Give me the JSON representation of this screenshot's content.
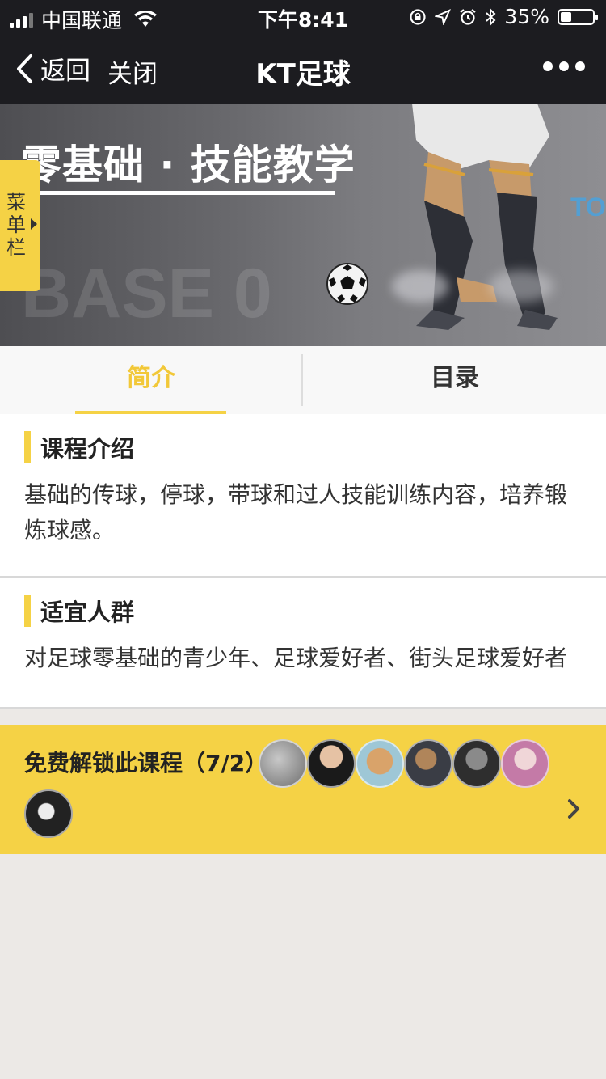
{
  "status_bar": {
    "carrier": "中国联通",
    "time": "下午8:41",
    "battery": "35%",
    "battery_level": 0.35
  },
  "nav": {
    "back_label": "返回",
    "close_label": "关闭",
    "title": "KT足球"
  },
  "banner": {
    "title": "零基础 · 技能教学",
    "watermark": "BASE 0",
    "logo_text": "TOI",
    "menu_tab_label": "菜单栏"
  },
  "tabs": [
    {
      "label": "简介",
      "active": true
    },
    {
      "label": "目录",
      "active": false
    }
  ],
  "sections": [
    {
      "title": "课程介绍",
      "body": "基础的传球，停球，带球和过人技能训练内容，培养锻炼球感。"
    },
    {
      "title": "适宜人群",
      "body": "对足球零基础的青少年、足球爱好者、街头足球爱好者"
    }
  ],
  "unlock": {
    "label": "免费解锁此课程（7/2）",
    "avatar_count": 7
  },
  "colors": {
    "accent": "#f5d245",
    "active_tab": "#f2c838",
    "nav_bg": "#1c1c20",
    "page_bg": "#ece9e6"
  }
}
